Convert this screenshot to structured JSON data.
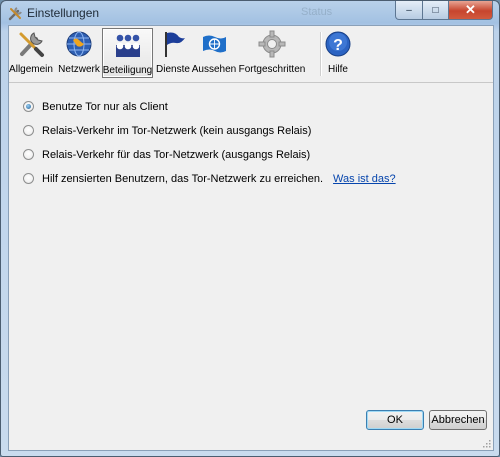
{
  "window": {
    "title": "Einstellungen",
    "background_title": "Status",
    "controls": {
      "minimize": "–",
      "maximize": "□",
      "close": "✕"
    }
  },
  "toolbar": {
    "items": [
      {
        "label": "Allgemein",
        "icon": "wrench-screwdriver-icon",
        "active": false
      },
      {
        "label": "Netzwerk",
        "icon": "globe-icon",
        "active": false
      },
      {
        "label": "Beteiligung",
        "icon": "relay-nodes-icon",
        "active": true
      },
      {
        "label": "Dienste",
        "icon": "flag-icon",
        "active": false
      },
      {
        "label": "Aussehen",
        "icon": "un-flag-icon",
        "active": false
      },
      {
        "label": "Fortgeschritten",
        "icon": "gear-icon",
        "active": false
      },
      {
        "label": "Hilfe",
        "icon": "help-icon",
        "active": false
      }
    ]
  },
  "options": {
    "client_only": {
      "label": "Benutze Tor nur als Client",
      "checked": true
    },
    "relay_traffic": {
      "label": "Relais-Verkehr im Tor-Netzwerk (kein ausgangs Relais)",
      "checked": false
    },
    "exit_relay": {
      "label": "Relais-Verkehr für das Tor-Netzwerk (ausgangs Relais)",
      "checked": false
    },
    "bridge": {
      "label": "Hilf zensierten Benutzern, das Tor-Netzwerk zu erreichen.",
      "checked": false,
      "link": "Was ist das?"
    }
  },
  "buttons": {
    "ok": "OK",
    "cancel": "Abbrechen"
  },
  "colors": {
    "link": "#0645ad",
    "title_bar": "#a3c1e2",
    "close_button": "#c7452e"
  }
}
